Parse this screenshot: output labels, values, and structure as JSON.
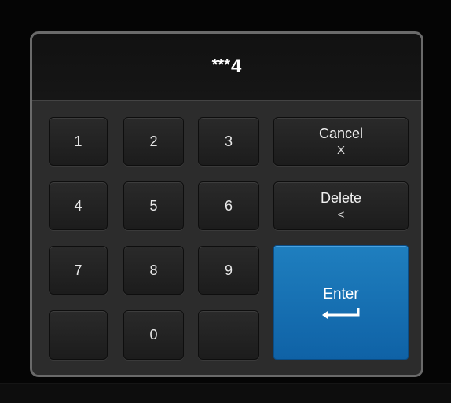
{
  "display": {
    "masked_prefix": "***",
    "last_digit": "4"
  },
  "keys": {
    "one": "1",
    "two": "2",
    "three": "3",
    "four": "4",
    "five": "5",
    "six": "6",
    "seven": "7",
    "eight": "8",
    "nine": "9",
    "zero": "0"
  },
  "cancel": {
    "label": "Cancel",
    "symbol": "X"
  },
  "delete": {
    "label": "Delete",
    "symbol": "<"
  },
  "enter": {
    "label": "Enter",
    "icon": "return-arrow-icon"
  },
  "colors": {
    "enter_accent": "#1670b4",
    "panel_border": "#6a6a6a",
    "key_background": "#222222"
  }
}
